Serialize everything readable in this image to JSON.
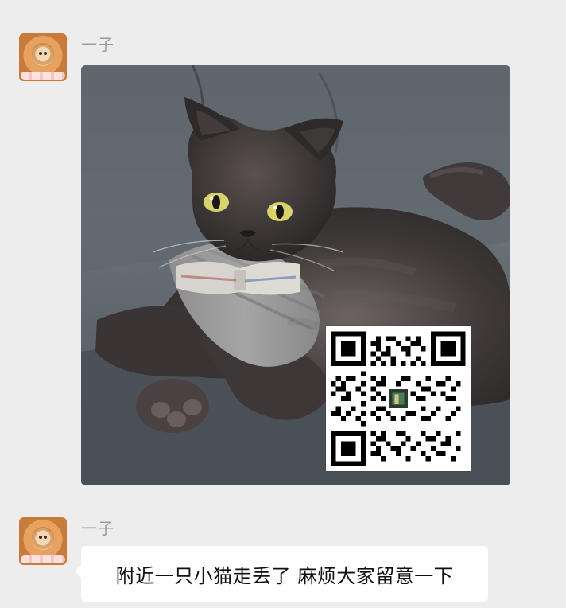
{
  "messages": [
    {
      "sender": "一子",
      "type": "image",
      "image": {
        "subject": "cat",
        "has_qr_code": true
      }
    },
    {
      "sender": "一子",
      "type": "text",
      "text": "附近一只小猫走丢了  麻烦大家留意一下"
    }
  ],
  "colors": {
    "background": "#ededed",
    "sender_name": "#9b9b9b",
    "text_bubble": "#ffffff"
  }
}
